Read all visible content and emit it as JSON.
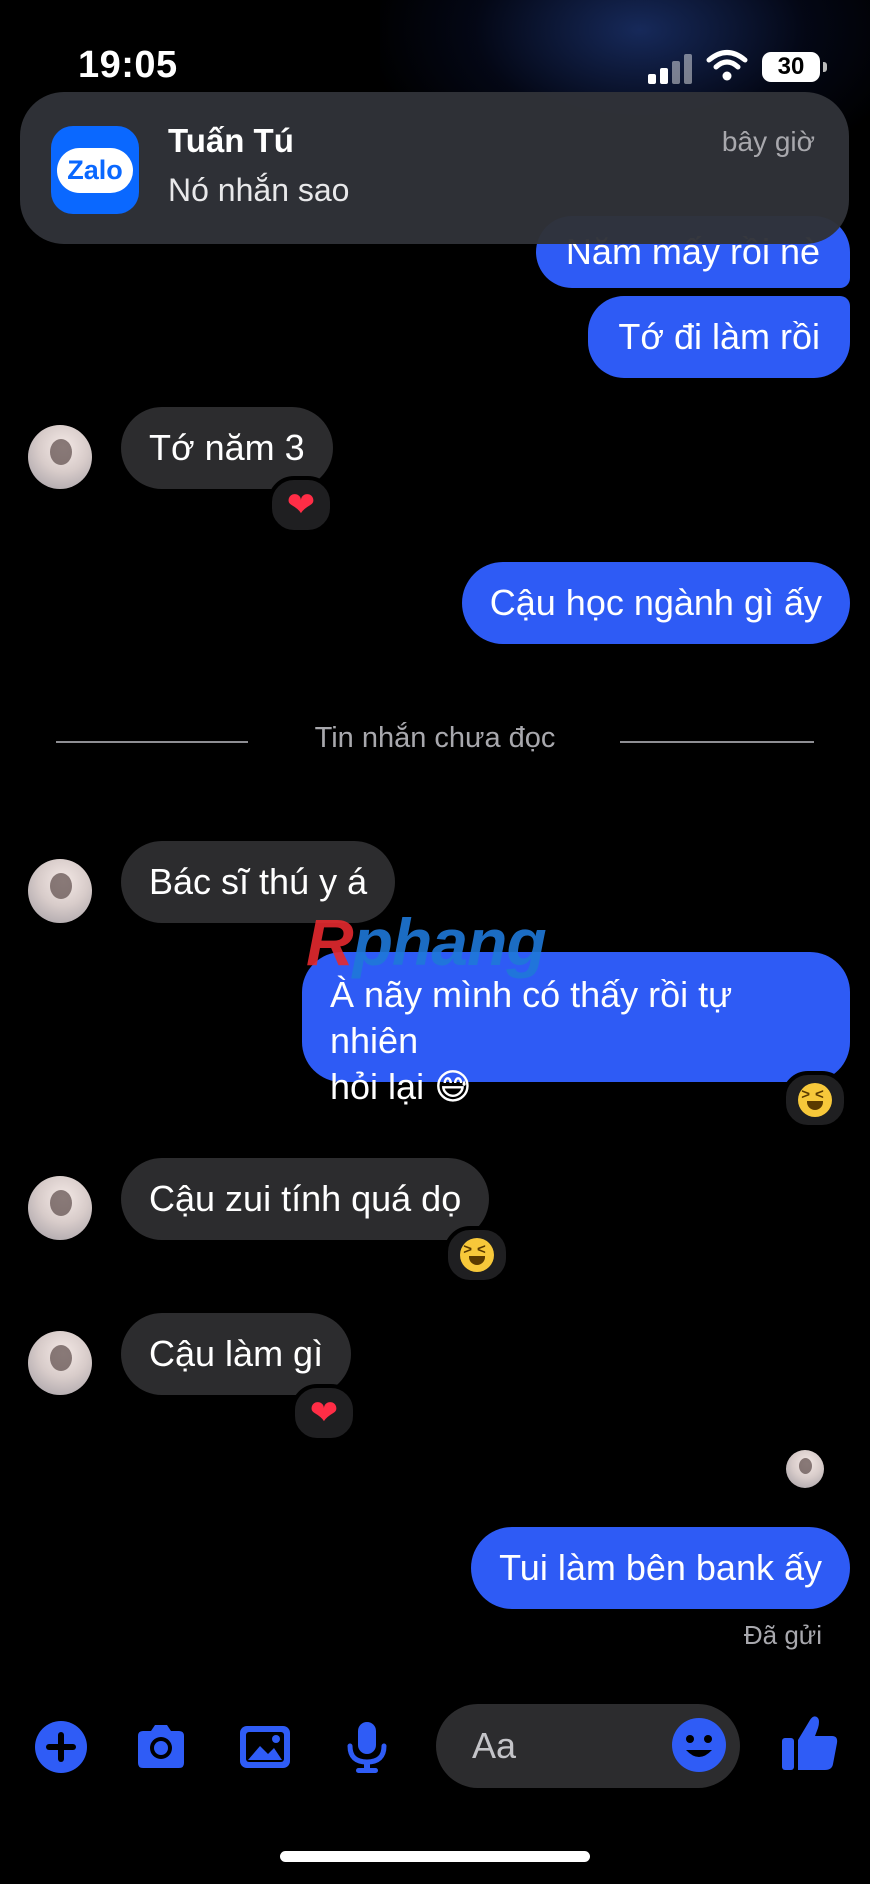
{
  "status_bar": {
    "time": "19:05",
    "battery": "30"
  },
  "notification": {
    "app_icon_label": "Zalo",
    "title": "Tuấn Tú",
    "body": "Nó nhắn sao",
    "time": "bây giờ"
  },
  "messages": [
    {
      "id": "m1",
      "from": "me",
      "text": "Năm mấy rồi nè"
    },
    {
      "id": "m2",
      "from": "me",
      "text": "Tớ đi làm rồi"
    },
    {
      "id": "m3",
      "from": "them",
      "text": "Tớ năm 3",
      "reaction": "heart"
    },
    {
      "id": "m4",
      "from": "me",
      "text": "Cậu học ngành gì ấy"
    },
    {
      "id": "m5",
      "from": "them",
      "text": "Bác sĩ thú y á"
    },
    {
      "id": "m6",
      "from": "me",
      "text": "À nãy mình có thấy rồi tự nhiên",
      "text2": "hỏi lại 😅",
      "reaction": "laughing"
    },
    {
      "id": "m7",
      "from": "them",
      "text": "Cậu zui tính quá dọ",
      "reaction": "laughing"
    },
    {
      "id": "m8",
      "from": "them",
      "text": "Cậu làm gì",
      "reaction": "heart"
    },
    {
      "id": "m9",
      "from": "me",
      "text": "Tui làm bên bank ấy"
    }
  ],
  "reaction_glyphs": {
    "heart": "❤"
  },
  "unread_divider": "Tin nhắn chưa đọc",
  "sent_status": "Đã gửi",
  "watermark": {
    "first": "R",
    "rest": "phang"
  },
  "composer": {
    "placeholder": "Aa",
    "icons": [
      "plus-icon",
      "camera-icon",
      "image-icon",
      "microphone-icon",
      "emoji-icon",
      "thumbs-up-icon"
    ]
  },
  "colors": {
    "outgoing_bubble": "#2e5bf5",
    "incoming_bubble": "#2c2c2e",
    "accent": "#2f5cf6"
  }
}
